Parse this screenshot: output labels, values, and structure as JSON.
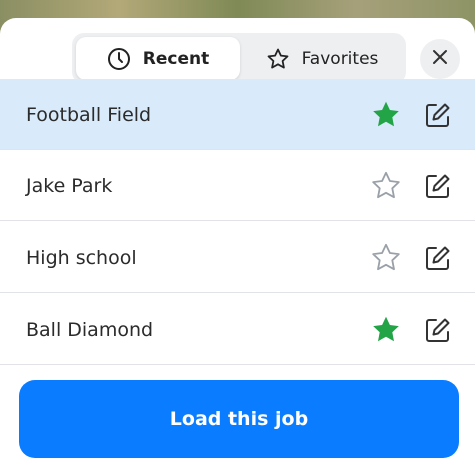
{
  "tabs": {
    "recent_label": "Recent",
    "favorites_label": "Favorites",
    "active": "Recent"
  },
  "jobs": [
    {
      "name": "Football Field",
      "favorite": true,
      "selected": true
    },
    {
      "name": "Jake Park",
      "favorite": false,
      "selected": false
    },
    {
      "name": "High school",
      "favorite": false,
      "selected": false
    },
    {
      "name": "Ball Diamond",
      "favorite": true,
      "selected": false
    }
  ],
  "primary_action": {
    "label": "Load this job"
  },
  "colors": {
    "accent": "#0a7cff",
    "favorite_star": "#22a447",
    "selected_row": "#d9eafb"
  },
  "icons": {
    "recent": "clock-icon",
    "favorites": "star-outline-icon",
    "close": "close-icon",
    "edit": "edit-icon"
  }
}
